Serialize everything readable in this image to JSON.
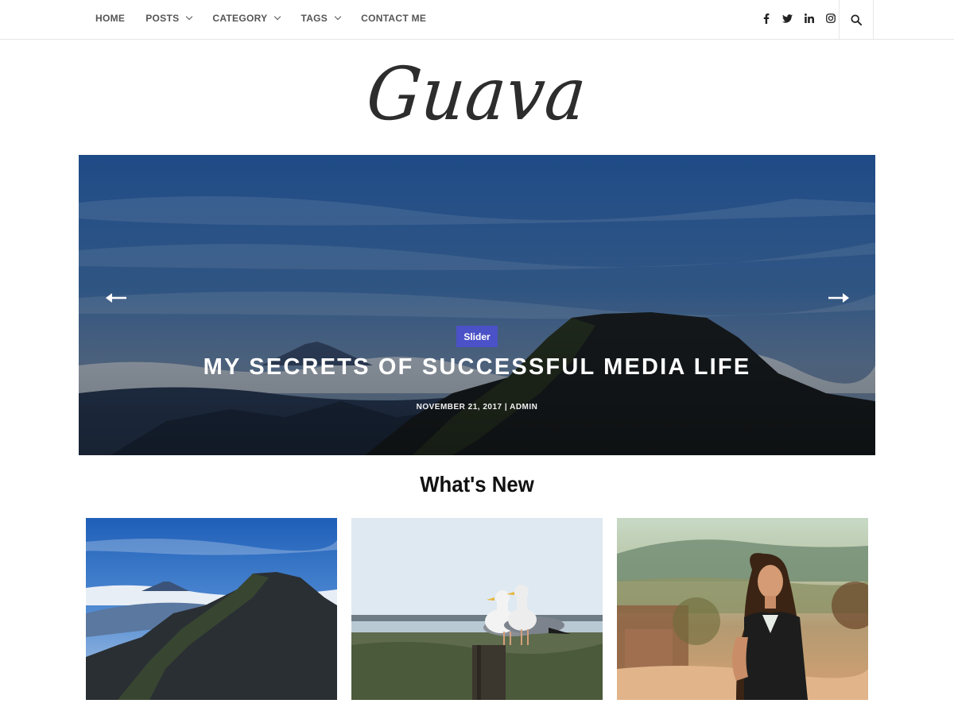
{
  "nav": {
    "items": [
      {
        "label": "HOME",
        "has_dropdown": false
      },
      {
        "label": "POSTS",
        "has_dropdown": true
      },
      {
        "label": "CATEGORY",
        "has_dropdown": true
      },
      {
        "label": "TAGS",
        "has_dropdown": true
      },
      {
        "label": "CONTACT ME",
        "has_dropdown": false
      }
    ],
    "social_icons": [
      "facebook-icon",
      "twitter-icon",
      "linkedin-icon",
      "instagram-icon"
    ],
    "search_icon": "search-icon"
  },
  "logo": {
    "text": "Guava"
  },
  "slider": {
    "badge": "Slider",
    "title": "MY SECRETS OF SUCCESSFUL MEDIA LIFE",
    "meta": "NOVEMBER 21, 2017 | ADMIN",
    "badge_color": "#4b51c6"
  },
  "section": {
    "title": "What's New"
  },
  "cards": [
    {
      "image": "mountain-peak-photo"
    },
    {
      "image": "seagulls-photo"
    },
    {
      "image": "woman-portrait-photo"
    }
  ]
}
